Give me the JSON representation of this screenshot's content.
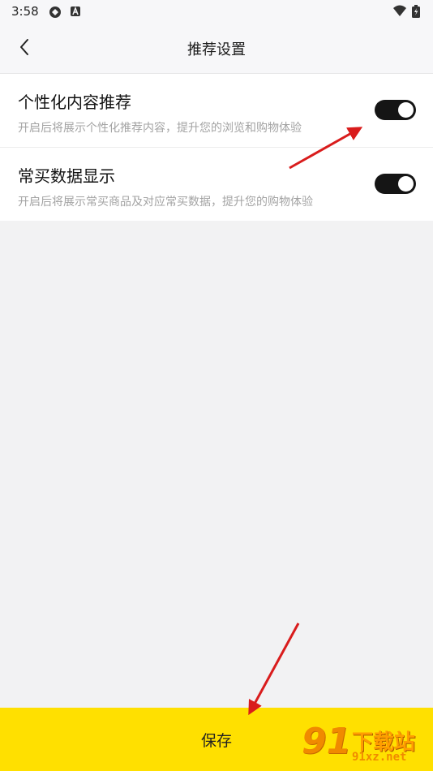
{
  "status_bar": {
    "time": "3:58"
  },
  "header": {
    "title": "推荐设置"
  },
  "settings": [
    {
      "title": "个性化内容推荐",
      "description": "开启后将展示个性化推荐内容，提升您的浏览和购物体验",
      "enabled": true
    },
    {
      "title": "常买数据显示",
      "description": "开启后将展示常买商品及对应常买数据，提升您的购物体验",
      "enabled": true
    }
  ],
  "footer": {
    "save_label": "保存"
  },
  "watermark": {
    "number": "91",
    "text": "下载站",
    "url": "91xz.net"
  },
  "colors": {
    "accent": "#ffe000",
    "toggle_on": "#151515",
    "arrow": "#d91c1c"
  }
}
